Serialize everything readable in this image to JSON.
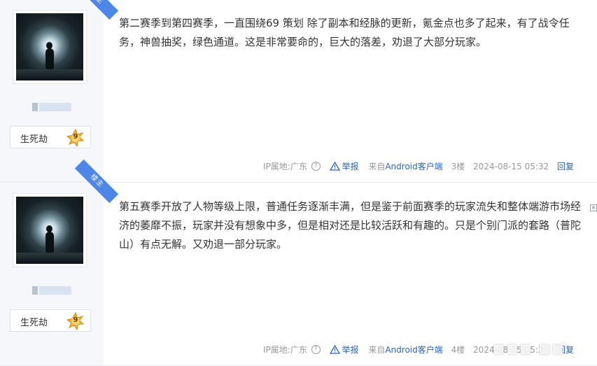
{
  "posts": [
    {
      "corner_badge": "楼主",
      "level_name": "生死劫",
      "level_num": "9",
      "content": "第二赛季到第四赛季，一直围绕69 策划 除了副本和经脉的更新，氪金点也多了起来，有了战令任务，神兽抽奖，绿色通道。这是非常要命的，巨大的落差，劝退了大部分玩家。",
      "ip": "IP属地:广东",
      "help_icon": "question-circle-icon",
      "report": "举报",
      "source_prefix": "来自",
      "source_link": "Android客户端",
      "floor": "3楼",
      "time": "2024-08-15 05:32",
      "reply": "回复"
    },
    {
      "corner_badge": "楼主",
      "level_name": "生死劫",
      "level_num": "9",
      "content": "第五赛季开放了人物等级上限，普通任务逐渐丰满，但是鉴于前面赛季的玩家流失和整体端游市场经济的萎靡不振，玩家并没有想象中多，但是相对还是比较活跃和有趣的。只是个别门派的套路（普陀山）有点无解。又劝退一部分玩家。",
      "ip": "IP属地:广东",
      "help_icon": "question-circle-icon",
      "report": "举报",
      "source_prefix": "来自",
      "source_link": "Android客户端",
      "floor": "4楼",
      "time": "2024-08-15 05:35",
      "reply": "回复"
    }
  ],
  "colors": {
    "link": "#2d64b3",
    "badge": "#4b86e8",
    "sidebar_bg": "#f5f7fa"
  }
}
